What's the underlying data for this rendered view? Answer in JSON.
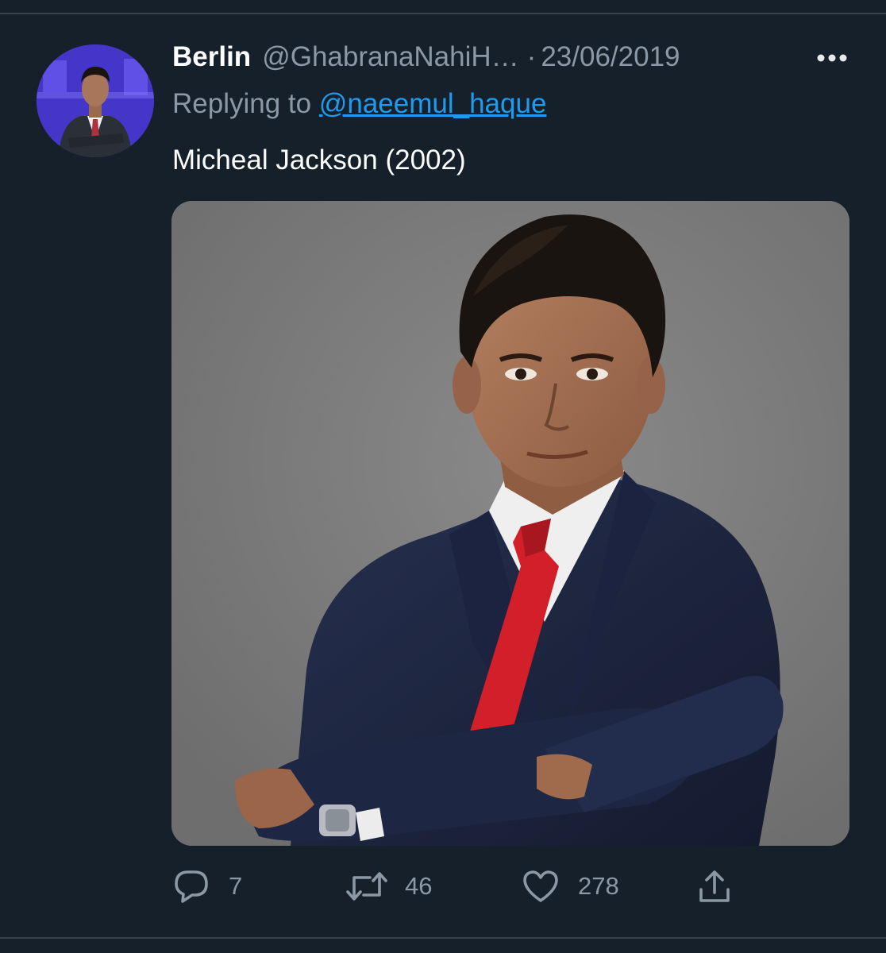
{
  "tweet": {
    "display_name": "Berlin",
    "handle": "@GhabranaNahiH…",
    "separator": "·",
    "timestamp": "23/06/2019",
    "replying_prefix": "Replying to ",
    "replying_to": "@naeemul_haque",
    "text": "Micheal Jackson (2002)",
    "media_alt": "photo of a man in a navy suit with a red tie, arms crossed",
    "avatar_alt": "profile picture of a man in a suit with arms crossed",
    "more_icon": "more-horizontal-icon"
  },
  "actions": {
    "reply": {
      "icon": "reply-icon",
      "count": "7"
    },
    "retweet": {
      "icon": "retweet-icon",
      "count": "46"
    },
    "like": {
      "icon": "heart-icon",
      "count": "278"
    },
    "share": {
      "icon": "share-icon"
    }
  },
  "colors": {
    "background": "#15202b",
    "divider": "#38444d",
    "primary_text": "#ffffff",
    "secondary_text": "#8b98a5",
    "link": "#1d9bf0",
    "media_background": "#7d7d7d",
    "suit": "#1c2540",
    "tie": "#d21f2a"
  }
}
